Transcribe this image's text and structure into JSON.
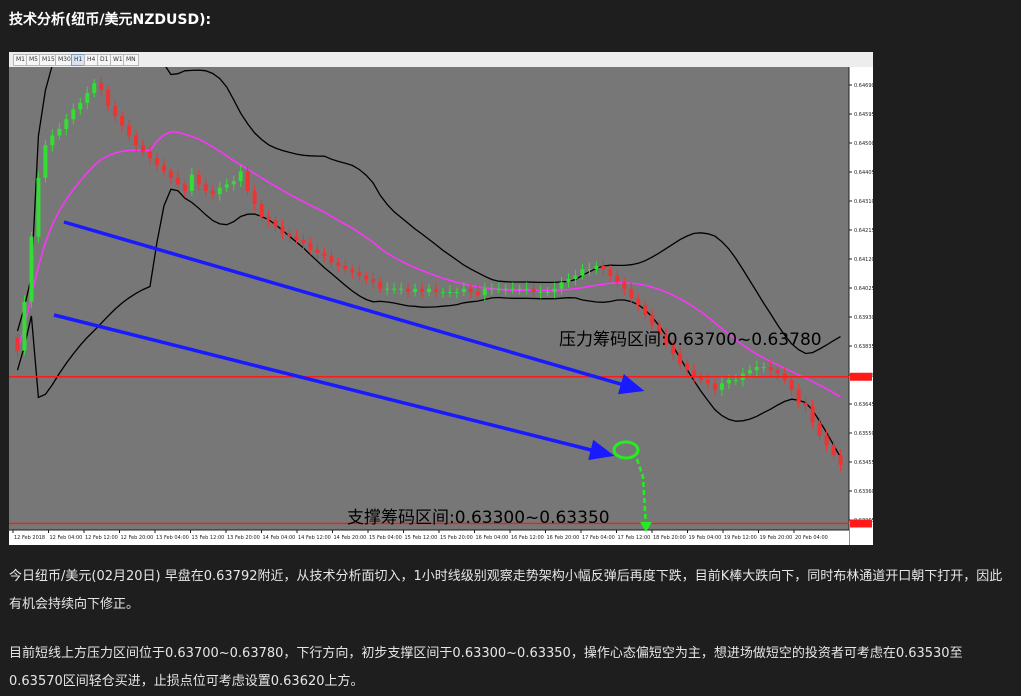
{
  "heading": "技术分析(纽币/美元NZDUSD):",
  "timeframes": [
    "M1",
    "M5",
    "M15",
    "M30",
    "H1",
    "H4",
    "D1",
    "W1",
    "MN"
  ],
  "active_timeframe": "H1",
  "chart_data": {
    "type": "candlestick",
    "title": "",
    "xlabel": "",
    "ylabel": "",
    "ylim": [
      0.6328,
      0.647
    ],
    "y_ticks": [
      "0.64690",
      "0.64595",
      "0.64500",
      "0.64405",
      "0.64310",
      "0.64215",
      "0.64120",
      "0.64025",
      "0.63930",
      "0.63835",
      "0.63740",
      "0.63645",
      "0.63550",
      "0.63455",
      "0.63360",
      "0.63265"
    ],
    "x_ticks": [
      "12 Feb 2018",
      "12 Feb 04:00",
      "12 Feb 12:00",
      "12 Feb 20:00",
      "13 Feb 04:00",
      "13 Feb 12:00",
      "13 Feb 20:00",
      "14 Feb 04:00",
      "14 Feb 12:00",
      "14 Feb 20:00",
      "15 Feb 04:00",
      "15 Feb 12:00",
      "15 Feb 20:00",
      "16 Feb 04:00",
      "16 Feb 12:00",
      "16 Feb 20:00",
      "17 Feb 04:00",
      "17 Feb 12:00",
      "18 Feb 20:00",
      "19 Feb 04:00",
      "19 Feb 12:00",
      "19 Feb 20:00",
      "20 Feb 04:00"
    ],
    "close": [
      0.6383,
      0.6398,
      0.6418,
      0.6436,
      0.6446,
      0.6449,
      0.6451,
      0.6454,
      0.6457,
      0.6459,
      0.6462,
      0.6465,
      0.6463,
      0.6458,
      0.6455,
      0.6452,
      0.6449,
      0.6446,
      0.6444,
      0.6442,
      0.644,
      0.6438,
      0.6436,
      0.6434,
      0.6432,
      0.6437,
      0.6434,
      0.6432,
      0.6431,
      0.6433,
      0.6434,
      0.6435,
      0.6438,
      0.6432,
      0.6428,
      0.6424,
      0.6423,
      0.6421,
      0.6419,
      0.6418,
      0.6417,
      0.6416,
      0.6414,
      0.6413,
      0.6412,
      0.641,
      0.6409,
      0.6408,
      0.6407,
      0.6406,
      0.6405,
      0.6404,
      0.6402,
      0.6402,
      0.6402,
      0.6402,
      0.6401,
      0.6402,
      0.6401,
      0.6402,
      0.6401,
      0.6401,
      0.6401,
      0.6401,
      0.6402,
      0.6401,
      0.64,
      0.6402,
      0.6402,
      0.6402,
      0.6402,
      0.6402,
      0.6402,
      0.6402,
      0.6401,
      0.6401,
      0.6401,
      0.6402,
      0.6404,
      0.6405,
      0.6406,
      0.6408,
      0.6408,
      0.6409,
      0.6408,
      0.6406,
      0.6404,
      0.6402,
      0.6399,
      0.6397,
      0.6394,
      0.6391,
      0.6388,
      0.6385,
      0.6382,
      0.6379,
      0.6377,
      0.6375,
      0.6374,
      0.6373,
      0.6371,
      0.6373,
      0.6374,
      0.6374,
      0.6376,
      0.6377,
      0.6378,
      0.6378,
      0.6377,
      0.6376,
      0.6374,
      0.6371,
      0.6367,
      0.6366,
      0.6361,
      0.6357,
      0.6354,
      0.6351,
      0.6348
    ],
    "bands": {
      "period": 20
    },
    "annotations": [
      {
        "text": "压力筹码区间:0.63700~0.63780"
      },
      {
        "text": "支撑筹码区间:0.63300~0.63350"
      }
    ],
    "hlines": [
      0.6375,
      0.633
    ],
    "hline_color": "#ff1a1a",
    "channel_color": "#1a1aff",
    "arrow_color": "#22ee22",
    "bull_color": "#33dd33",
    "bear_color": "#ee3333",
    "middle_band_color": "#ff33ff"
  },
  "paragraphs": [
    "今日纽币/美元(02月20日) 早盘在0.63792附近，从技术分析面切入，1小时线级别观察走势架构小幅反弹后再度下跌，目前K棒大跌向下，同时布林通道开口朝下打开，因此有机会持续向下修正。",
    "目前短线上方压力区间位于0.63700~0.63780，下行方向，初步支撑区间于0.63300~0.63350，操作心态偏短空为主，想进场做短空的投资者可考虑在0.63530至0.63570区间轻仓买进，止损点位可考虑设置0.63620上方。"
  ]
}
